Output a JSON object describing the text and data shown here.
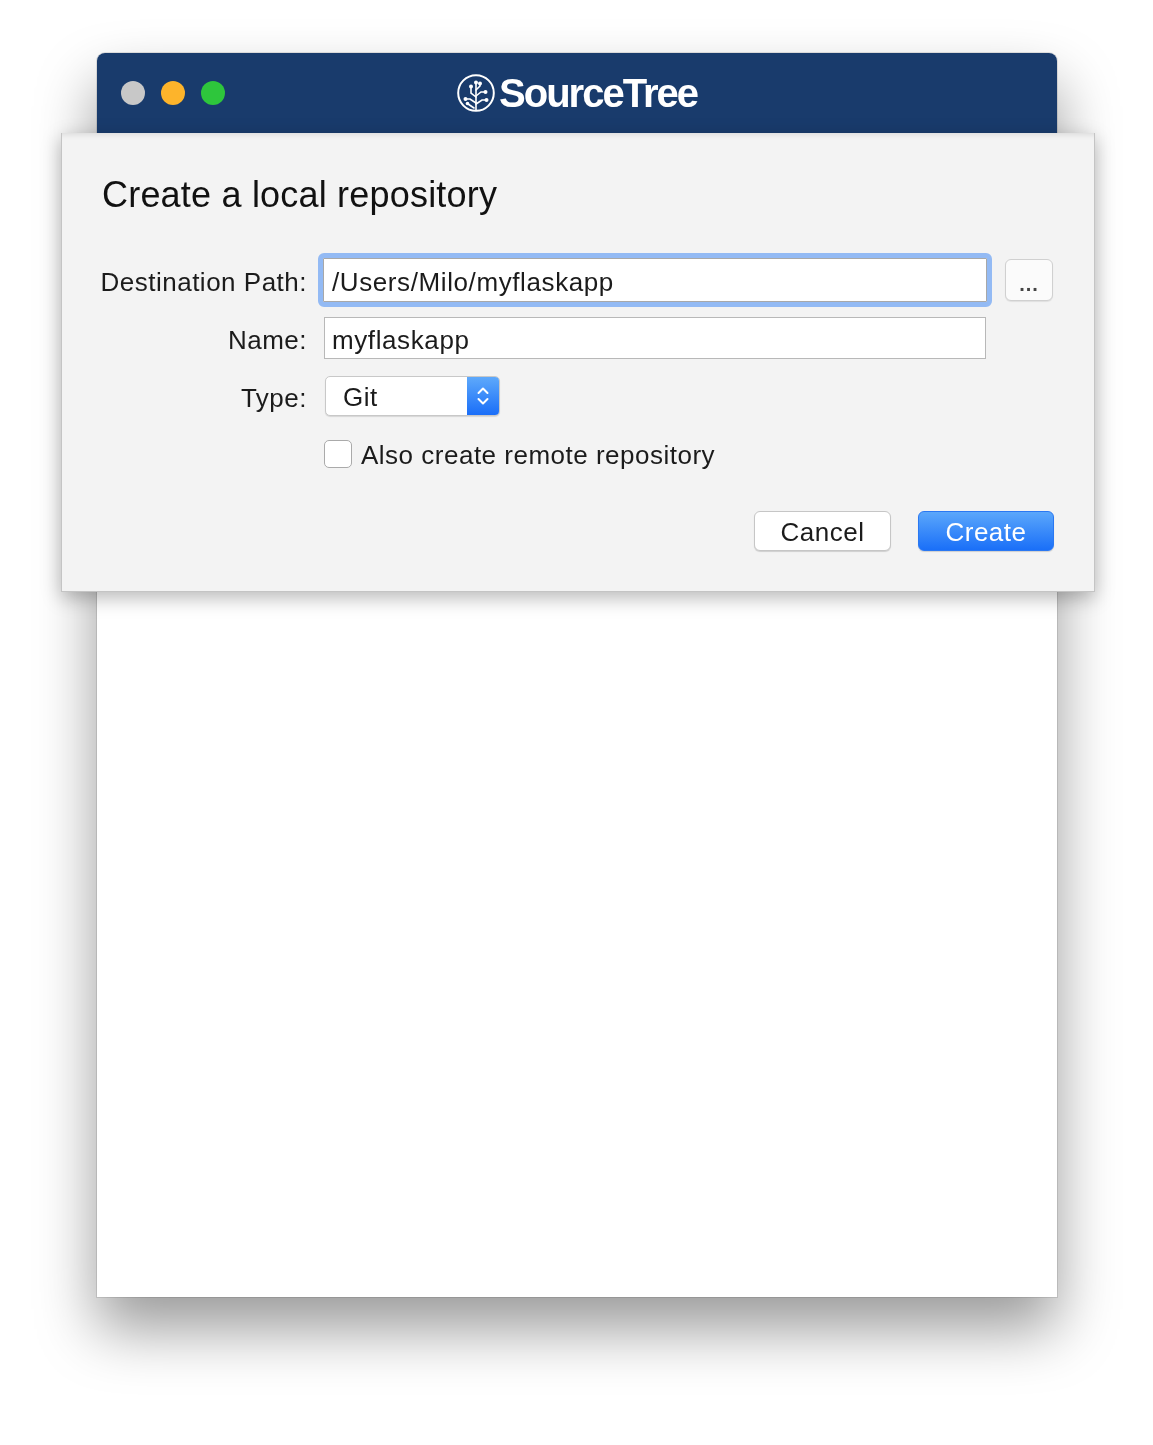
{
  "window": {
    "title": "SourceTree",
    "controls": [
      {
        "kind": "close",
        "disabled": true
      },
      {
        "kind": "minimize",
        "disabled": false
      },
      {
        "kind": "maximize",
        "disabled": false
      }
    ]
  },
  "dialog": {
    "title": "Create a local repository",
    "fields": [
      {
        "kind": "text",
        "label": "Destination Path:",
        "value": "/Users/Milo/myflaskapp",
        "focused": true,
        "browse_button": "..."
      },
      {
        "kind": "text",
        "label": "Name:",
        "value": "myflaskapp",
        "focused": false
      },
      {
        "kind": "popup",
        "label": "Type:",
        "value": "Git"
      }
    ],
    "checkbox": {
      "label": "Also create remote repository",
      "checked": false
    },
    "buttons": [
      {
        "label": "Cancel",
        "default": false
      },
      {
        "label": "Create",
        "default": true
      }
    ]
  }
}
